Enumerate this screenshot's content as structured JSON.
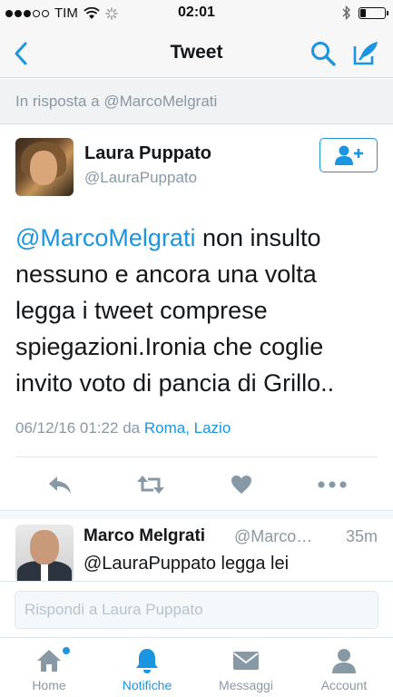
{
  "status_bar": {
    "carrier": "TIM",
    "time": "02:01"
  },
  "nav": {
    "title": "Tweet",
    "back_icon": "chevron-left-icon",
    "search_icon": "search-icon",
    "compose_icon": "compose-icon"
  },
  "reply_banner": {
    "text": "In risposta a @MarcoMelgrati"
  },
  "tweet": {
    "author_name": "Laura Puppato",
    "author_handle": "@LauraPuppato",
    "mention": "@MarcoMelgrati",
    "text": " non insulto nessuno e ancora una volta legga i tweet comprese spiegazioni.Ironia che coglie invito voto di pancia di Grillo..",
    "date": "06/12/16 01:22",
    "via": "da",
    "location": "Roma, Lazio"
  },
  "reply": {
    "author_name": "Marco Melgrati",
    "author_handle": "@Marco…",
    "time": "35m",
    "text": "@LauraPuppato legga lei"
  },
  "compose": {
    "placeholder": "Rispondi a Laura Puppato"
  },
  "tabs": [
    {
      "label": "Home",
      "icon": "home-icon",
      "active": false
    },
    {
      "label": "Notifiche",
      "icon": "bell-icon",
      "active": true
    },
    {
      "label": "Messaggi",
      "icon": "envelope-icon",
      "active": false
    },
    {
      "label": "Account",
      "icon": "person-icon",
      "active": false
    }
  ],
  "colors": {
    "accent": "#1b95e0",
    "muted": "#8899a6",
    "text": "#14171a"
  }
}
